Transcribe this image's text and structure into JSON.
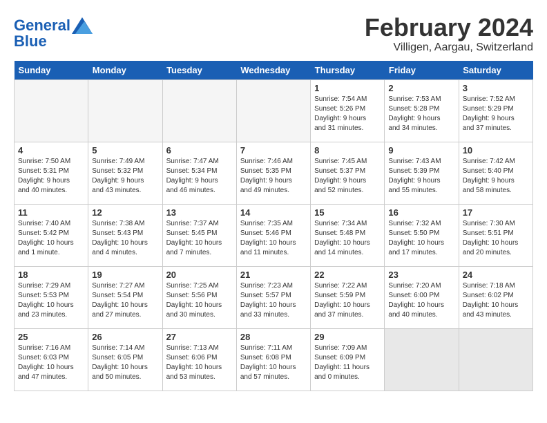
{
  "header": {
    "logo_line1": "General",
    "logo_line2": "Blue",
    "month_title": "February 2024",
    "subtitle": "Villigen, Aargau, Switzerland"
  },
  "weekdays": [
    "Sunday",
    "Monday",
    "Tuesday",
    "Wednesday",
    "Thursday",
    "Friday",
    "Saturday"
  ],
  "weeks": [
    [
      {
        "day": "",
        "info": "",
        "empty": true
      },
      {
        "day": "",
        "info": "",
        "empty": true
      },
      {
        "day": "",
        "info": "",
        "empty": true
      },
      {
        "day": "",
        "info": "",
        "empty": true
      },
      {
        "day": "1",
        "info": "Sunrise: 7:54 AM\nSunset: 5:26 PM\nDaylight: 9 hours\nand 31 minutes."
      },
      {
        "day": "2",
        "info": "Sunrise: 7:53 AM\nSunset: 5:28 PM\nDaylight: 9 hours\nand 34 minutes."
      },
      {
        "day": "3",
        "info": "Sunrise: 7:52 AM\nSunset: 5:29 PM\nDaylight: 9 hours\nand 37 minutes."
      }
    ],
    [
      {
        "day": "4",
        "info": "Sunrise: 7:50 AM\nSunset: 5:31 PM\nDaylight: 9 hours\nand 40 minutes."
      },
      {
        "day": "5",
        "info": "Sunrise: 7:49 AM\nSunset: 5:32 PM\nDaylight: 9 hours\nand 43 minutes."
      },
      {
        "day": "6",
        "info": "Sunrise: 7:47 AM\nSunset: 5:34 PM\nDaylight: 9 hours\nand 46 minutes."
      },
      {
        "day": "7",
        "info": "Sunrise: 7:46 AM\nSunset: 5:35 PM\nDaylight: 9 hours\nand 49 minutes."
      },
      {
        "day": "8",
        "info": "Sunrise: 7:45 AM\nSunset: 5:37 PM\nDaylight: 9 hours\nand 52 minutes."
      },
      {
        "day": "9",
        "info": "Sunrise: 7:43 AM\nSunset: 5:39 PM\nDaylight: 9 hours\nand 55 minutes."
      },
      {
        "day": "10",
        "info": "Sunrise: 7:42 AM\nSunset: 5:40 PM\nDaylight: 9 hours\nand 58 minutes."
      }
    ],
    [
      {
        "day": "11",
        "info": "Sunrise: 7:40 AM\nSunset: 5:42 PM\nDaylight: 10 hours\nand 1 minute."
      },
      {
        "day": "12",
        "info": "Sunrise: 7:38 AM\nSunset: 5:43 PM\nDaylight: 10 hours\nand 4 minutes."
      },
      {
        "day": "13",
        "info": "Sunrise: 7:37 AM\nSunset: 5:45 PM\nDaylight: 10 hours\nand 7 minutes."
      },
      {
        "day": "14",
        "info": "Sunrise: 7:35 AM\nSunset: 5:46 PM\nDaylight: 10 hours\nand 11 minutes."
      },
      {
        "day": "15",
        "info": "Sunrise: 7:34 AM\nSunset: 5:48 PM\nDaylight: 10 hours\nand 14 minutes."
      },
      {
        "day": "16",
        "info": "Sunrise: 7:32 AM\nSunset: 5:50 PM\nDaylight: 10 hours\nand 17 minutes."
      },
      {
        "day": "17",
        "info": "Sunrise: 7:30 AM\nSunset: 5:51 PM\nDaylight: 10 hours\nand 20 minutes."
      }
    ],
    [
      {
        "day": "18",
        "info": "Sunrise: 7:29 AM\nSunset: 5:53 PM\nDaylight: 10 hours\nand 23 minutes."
      },
      {
        "day": "19",
        "info": "Sunrise: 7:27 AM\nSunset: 5:54 PM\nDaylight: 10 hours\nand 27 minutes."
      },
      {
        "day": "20",
        "info": "Sunrise: 7:25 AM\nSunset: 5:56 PM\nDaylight: 10 hours\nand 30 minutes."
      },
      {
        "day": "21",
        "info": "Sunrise: 7:23 AM\nSunset: 5:57 PM\nDaylight: 10 hours\nand 33 minutes."
      },
      {
        "day": "22",
        "info": "Sunrise: 7:22 AM\nSunset: 5:59 PM\nDaylight: 10 hours\nand 37 minutes."
      },
      {
        "day": "23",
        "info": "Sunrise: 7:20 AM\nSunset: 6:00 PM\nDaylight: 10 hours\nand 40 minutes."
      },
      {
        "day": "24",
        "info": "Sunrise: 7:18 AM\nSunset: 6:02 PM\nDaylight: 10 hours\nand 43 minutes."
      }
    ],
    [
      {
        "day": "25",
        "info": "Sunrise: 7:16 AM\nSunset: 6:03 PM\nDaylight: 10 hours\nand 47 minutes."
      },
      {
        "day": "26",
        "info": "Sunrise: 7:14 AM\nSunset: 6:05 PM\nDaylight: 10 hours\nand 50 minutes."
      },
      {
        "day": "27",
        "info": "Sunrise: 7:13 AM\nSunset: 6:06 PM\nDaylight: 10 hours\nand 53 minutes."
      },
      {
        "day": "28",
        "info": "Sunrise: 7:11 AM\nSunset: 6:08 PM\nDaylight: 10 hours\nand 57 minutes."
      },
      {
        "day": "29",
        "info": "Sunrise: 7:09 AM\nSunset: 6:09 PM\nDaylight: 11 hours\nand 0 minutes."
      },
      {
        "day": "",
        "info": "",
        "empty": true,
        "shaded": true
      },
      {
        "day": "",
        "info": "",
        "empty": true,
        "shaded": true
      }
    ]
  ]
}
